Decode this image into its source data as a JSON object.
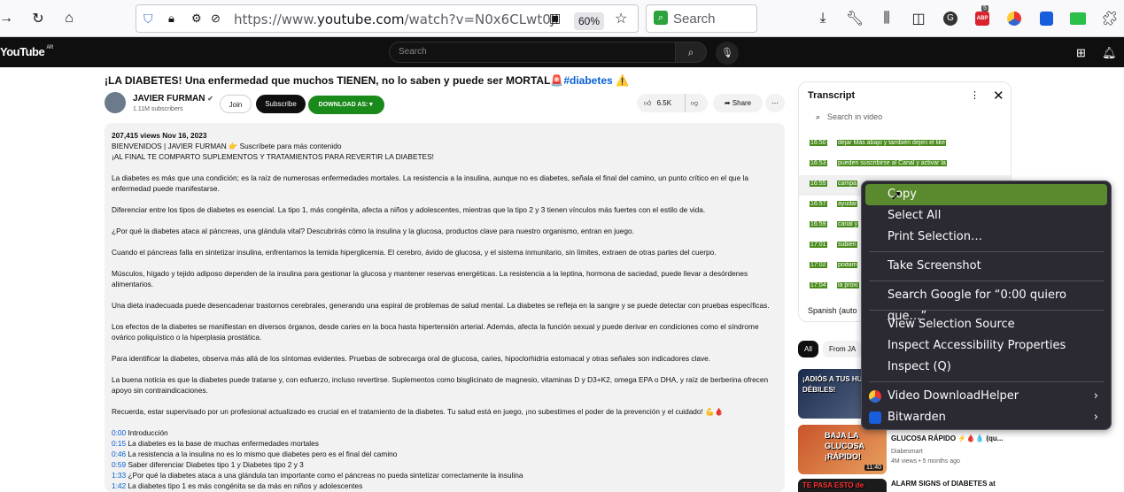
{
  "browser": {
    "url_prefix": "https://www.",
    "url_domain": "youtube.com",
    "url_path": "/watch?v=N0x6CLwt0JI",
    "zoom": "60%",
    "search_placeholder": "Search",
    "abp_badge": "5"
  },
  "yt": {
    "logo": "YouTube",
    "logo_country": "AR",
    "search_placeholder": "Search"
  },
  "video": {
    "title": "¡LA DIABETES! Una enfermedad que muchos TIENEN, no lo saben y puede ser MORTAL🚨",
    "title_tag": "#diabetes",
    "title_suffix": " ⚠️",
    "channel": "JAVIER FURMAN",
    "subscribers": "1.11M subscribers",
    "join": "Join",
    "subscribe": "Subscribe",
    "download": "DOWNLOAD AS:▼",
    "likes": "6.5K",
    "share": "Share"
  },
  "description": {
    "stats": "207,415 views  Nov 16, 2023",
    "lines": [
      "BIENVENIDOS | JAVIER FURMAN 👉 Suscríbete para más contenido",
      "¡AL FINAL TE COMPARTO SUPLEMENTOS Y TRATAMIENTOS PARA REVERTIR LA DIABETES!"
    ],
    "paragraphs": [
      "La diabetes es más que una condición; es la raíz de numerosas enfermedades mortales. La resistencia a la insulina, aunque no es diabetes, señala el final del camino, un punto crítico en el que la enfermedad puede manifestarse.",
      "Diferenciar entre los tipos de diabetes es esencial. La tipo 1, más congénita, afecta a niños y adolescentes, mientras que la tipo 2 y 3 tienen vínculos más fuertes con el estilo de vida.",
      "¿Por qué la diabetes ataca al páncreas, una glándula vital? Descubrirás cómo la insulina y la glucosa, productos clave para nuestro organismo, entran en juego.",
      "Cuando el páncreas falla en sintetizar insulina, enfrentamos la temida hiperglicemia. El cerebro, ávido de glucosa, y el sistema inmunitario, sin límites, extraen de otras partes del cuerpo.",
      "Músculos, hígado y tejido adiposo dependen de la insulina para gestionar la glucosa y mantener reservas energéticas. La resistencia a la leptina, hormona de saciedad, puede llevar a desórdenes alimentarios.",
      "Una dieta inadecuada puede desencadenar trastornos cerebrales, generando una espiral de problemas de salud mental. La diabetes se refleja en la sangre y se puede detectar con pruebas específicas.",
      "Los efectos de la diabetes se manifiestan en diversos órganos, desde caries en la boca hasta hipertensión arterial. Además, afecta la función sexual y puede derivar en condiciones como el síndrome ovárico poliquístico o la hiperplasia prostática.",
      "Para identificar la diabetes, observa más allá de los síntomas evidentes. Pruebas de sobrecarga oral de glucosa, caries, hipoclorhidria estomacal y otras señales son indicadores clave.",
      "La buena noticia es que la diabetes puede tratarse y, con esfuerzo, incluso revertirse. Suplementos como bisglicinato de magnesio, vitaminas D y D3+K2, omega EPA o DHA, y raíz de berberina ofrecen apoyo sin contraindicaciones.",
      "Recuerda, estar supervisado por un profesional actualizado es crucial en el tratamiento de la diabetes. Tu salud está en juego, ¡no subestimes el poder de la prevención y el cuidado! 💪🩸"
    ],
    "chapters": [
      {
        "time": "0:00",
        "text": "Introducción"
      },
      {
        "time": "0:15",
        "text": "La diabetes es la base de muchas enfermedades mortales"
      },
      {
        "time": "0:46",
        "text": "La resistencia a la insulina no es lo mismo que diabetes pero es el final del camino"
      },
      {
        "time": "0:59",
        "text": "Saber diferenciar Diabetes tipo 1 y Diabetes tipo 2 y 3"
      },
      {
        "time": "1:33",
        "text": "¿Por qué la diabetes ataca a una glándula tan importante como el páncreas no pueda sintetizar correctamente la insulina"
      },
      {
        "time": "1:42",
        "text": "La diabetes tipo 1 es más congénita se da más en niños y adolescentes"
      }
    ]
  },
  "transcript": {
    "title": "Transcript",
    "search_placeholder": "Search in video",
    "language": "Spanish (auto",
    "lines": [
      {
        "time": "16:50",
        "text": "dejar Más abajo y también dejen el like"
      },
      {
        "time": "16:53",
        "text": "pueden suscribirse al Canal y activar la"
      },
      {
        "time": "16:55",
        "text": "campa"
      },
      {
        "time": "16:57",
        "text": "ayudar"
      },
      {
        "time": "16:59",
        "text": "canal y"
      },
      {
        "time": "17:01",
        "text": "subien"
      },
      {
        "time": "17:02",
        "text": "podam"
      },
      {
        "time": "17:04",
        "text": "la proxi"
      }
    ]
  },
  "chips": {
    "all": "All",
    "from": "From JA"
  },
  "recommendations": [
    {
      "thumb_caption": "¡ADIÓS A TUS HUESOS DÉBILES!",
      "duration": "",
      "title": "",
      "meta": ""
    },
    {
      "thumb_caption": "BAJA LA GLUCOSA ¡RÁPIDO!",
      "duration": "11:40",
      "title": "GLUCOSA RÁPIDO ⚡🩸💧 (qu...",
      "channel": "Diabesmart",
      "meta": "4M views  •  5 months ago"
    },
    {
      "thumb_caption": "TE PASA ESTO de NOCHE?",
      "duration": "",
      "title": "ALARM SIGNS of DIABETES at",
      "meta": ""
    }
  ],
  "context_menu": {
    "items": [
      {
        "label": "Copy",
        "accel": "C"
      },
      {
        "label": "Select All",
        "accel": "A"
      },
      {
        "label": "Print Selection…",
        "accel": "r"
      },
      {
        "label": "Take Screenshot",
        "accel": "T"
      },
      {
        "label": "Search Google for “0:00 quiero que…”",
        "accel": "S"
      },
      {
        "label": "View Selection Source",
        "accel": "e"
      },
      {
        "label": "Inspect Accessibility Properties",
        "accel": ""
      },
      {
        "label": "Inspect (Q)",
        "accel": "Q"
      },
      {
        "label": "Video DownloadHelper",
        "accel": ""
      },
      {
        "label": "Bitwarden",
        "accel": ""
      }
    ]
  },
  "colors": {
    "transcript_highlight": "#4a8c1c",
    "menu_active": "#5a8a2e",
    "subscribe_bg": "#0f0f0f",
    "download_bg": "#1a8a1a"
  }
}
